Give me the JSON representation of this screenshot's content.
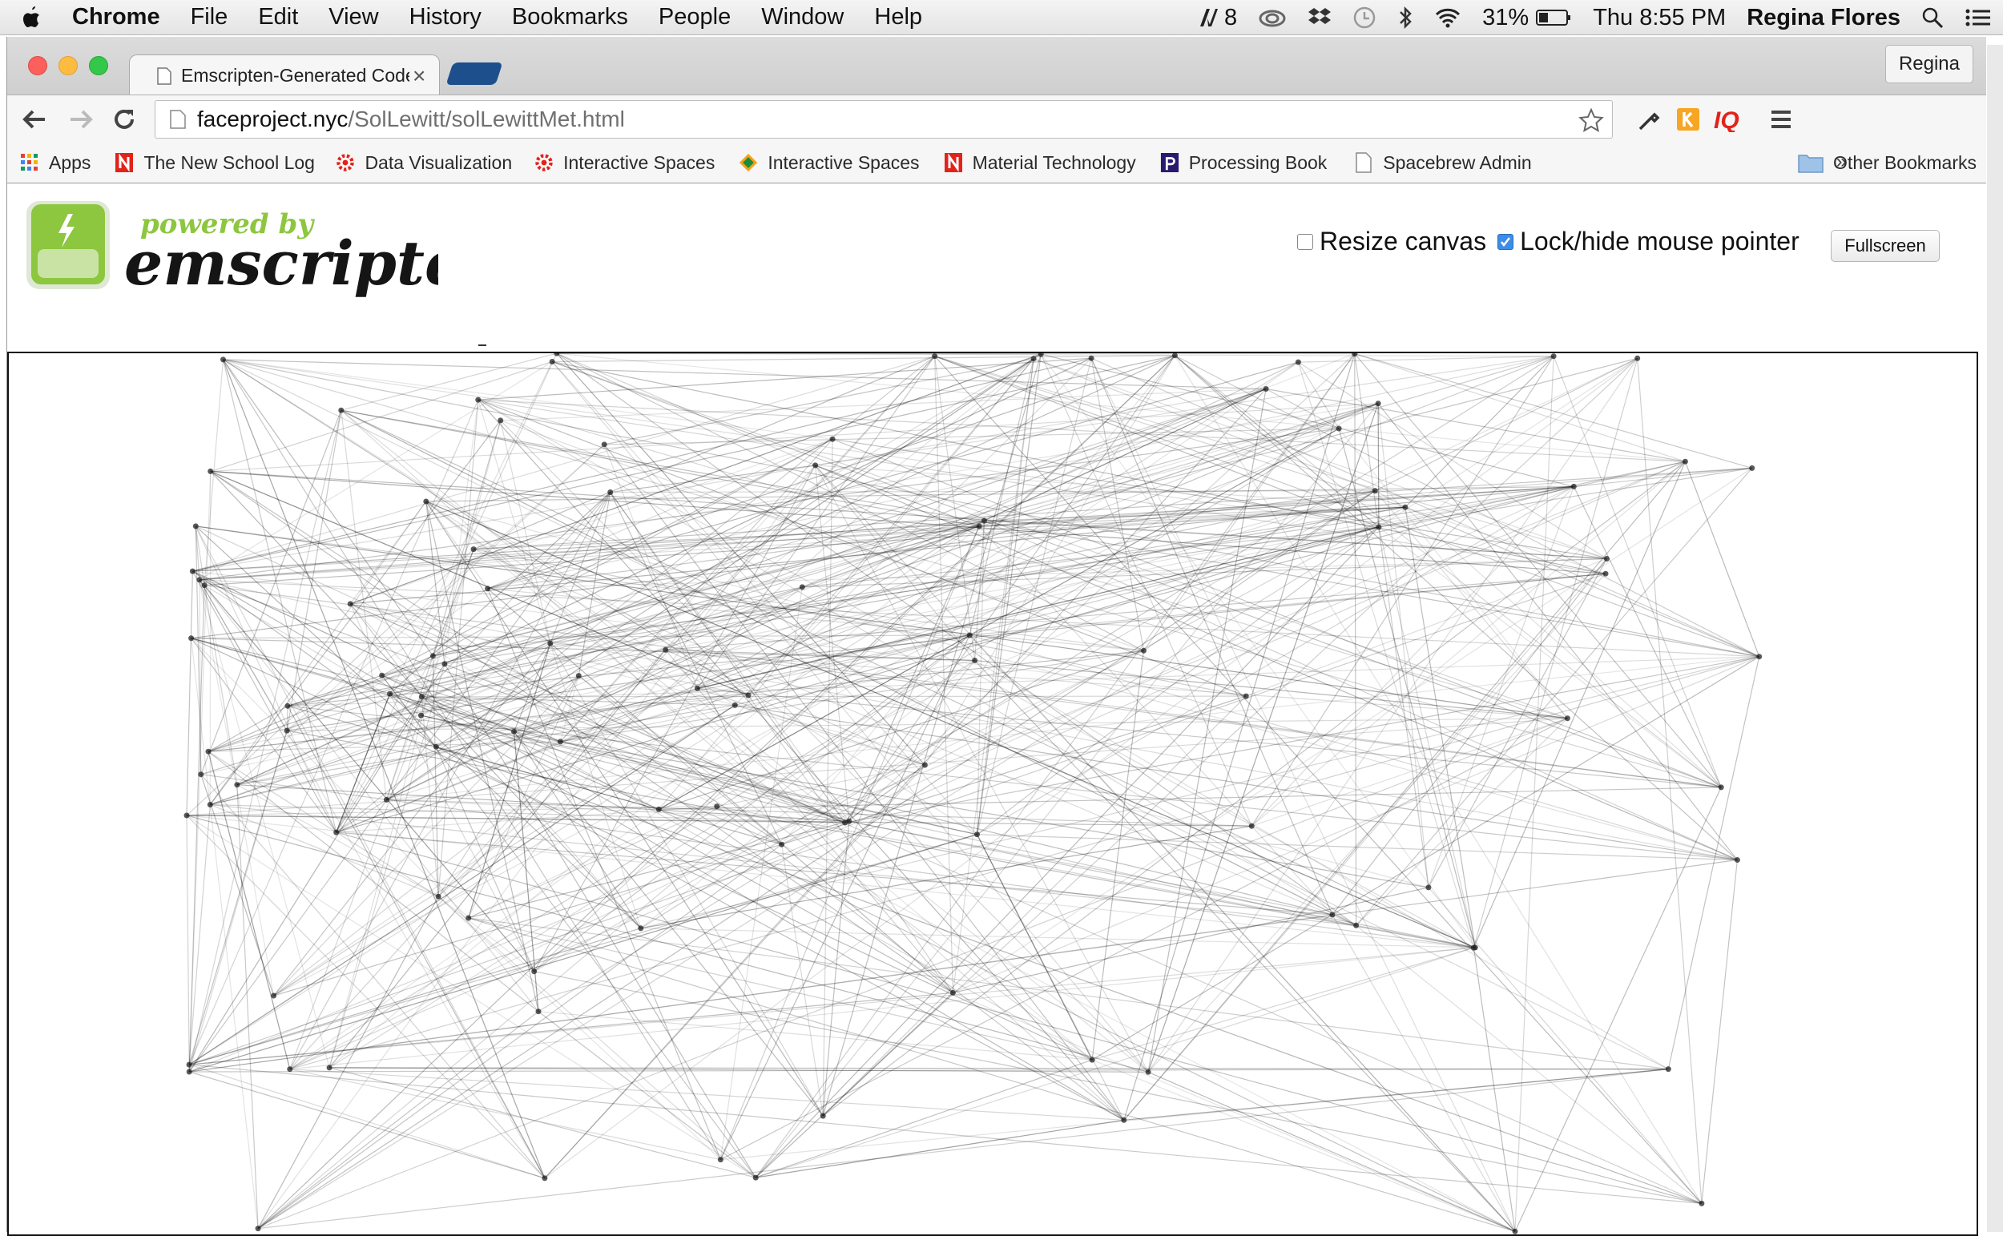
{
  "menubar": {
    "app": "Chrome",
    "items": [
      "File",
      "Edit",
      "View",
      "History",
      "Bookmarks",
      "People",
      "Window",
      "Help"
    ],
    "status": {
      "adobe_count": "8",
      "battery": "31%",
      "clock": "Thu 8:55 PM",
      "user": "Regina Flores"
    }
  },
  "browser": {
    "tab_title": "Emscripten-Generated Code",
    "profile": "Regina",
    "url_host": "faceproject.nyc",
    "url_path": "/SolLewitt/solLewittMet.html",
    "bookmarks": [
      {
        "label": "Apps",
        "icon": "apps-grid-icon"
      },
      {
        "label": "The New School Log",
        "icon": "new-school-icon"
      },
      {
        "label": "Data Visualization",
        "icon": "gear-red-icon"
      },
      {
        "label": "Interactive Spaces",
        "icon": "gear-red-icon"
      },
      {
        "label": "Interactive Spaces",
        "icon": "diamond-icon"
      },
      {
        "label": "Material Technology",
        "icon": "new-school-icon"
      },
      {
        "label": "Processing Book",
        "icon": "processing-icon"
      },
      {
        "label": "Spacebrew Admin",
        "icon": "page-icon"
      }
    ],
    "overflow": "»",
    "other_bookmarks": "Other Bookmarks"
  },
  "page": {
    "logo_tagline": "powered by",
    "logo_word": "emscripten",
    "controls": {
      "resize_label": "Resize canvas",
      "resize_checked": false,
      "lock_label": "Lock/hide mouse pointer",
      "lock_checked": true,
      "fullscreen_label": "Fullscreen"
    }
  },
  "colors": {
    "accent_green": "#8dc63f",
    "tab_blue": "#1d4f8c",
    "checkbox_blue": "#3b8ee8"
  }
}
